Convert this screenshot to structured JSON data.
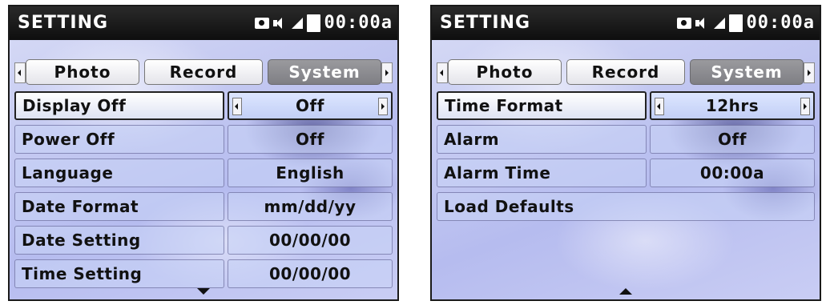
{
  "left": {
    "title": "SETTING",
    "clock": "00:00a",
    "tabs": [
      "Photo",
      "Record",
      "System"
    ],
    "rows": [
      {
        "label": "Display Off",
        "value": "Off"
      },
      {
        "label": "Power Off",
        "value": "Off"
      },
      {
        "label": "Language",
        "value": "English"
      },
      {
        "label": "Date Format",
        "value": "mm/dd/yy"
      },
      {
        "label": "Date Setting",
        "value": "00/00/00"
      },
      {
        "label": "Time Setting",
        "value": "00/00/00"
      }
    ]
  },
  "right": {
    "title": "SETTING",
    "clock": "00:00a",
    "tabs": [
      "Photo",
      "Record",
      "System"
    ],
    "rows": [
      {
        "label": "Time Format",
        "value": "12hrs"
      },
      {
        "label": "Alarm",
        "value": "Off"
      },
      {
        "label": "Alarm Time",
        "value": "00:00a"
      }
    ],
    "load_defaults": "Load Defaults"
  },
  "icons": [
    "camera-icon",
    "speaker-icon",
    "signal-icon",
    "battery-icon",
    "arrow-left-icon",
    "arrow-right-icon",
    "scroll-down-icon",
    "scroll-up-icon"
  ],
  "colors": {
    "titlebar": "#111111",
    "selected_tab": "#8a8a8e",
    "row_bg": "#c8d4f6",
    "screen_bg": "#c4c9f1"
  }
}
